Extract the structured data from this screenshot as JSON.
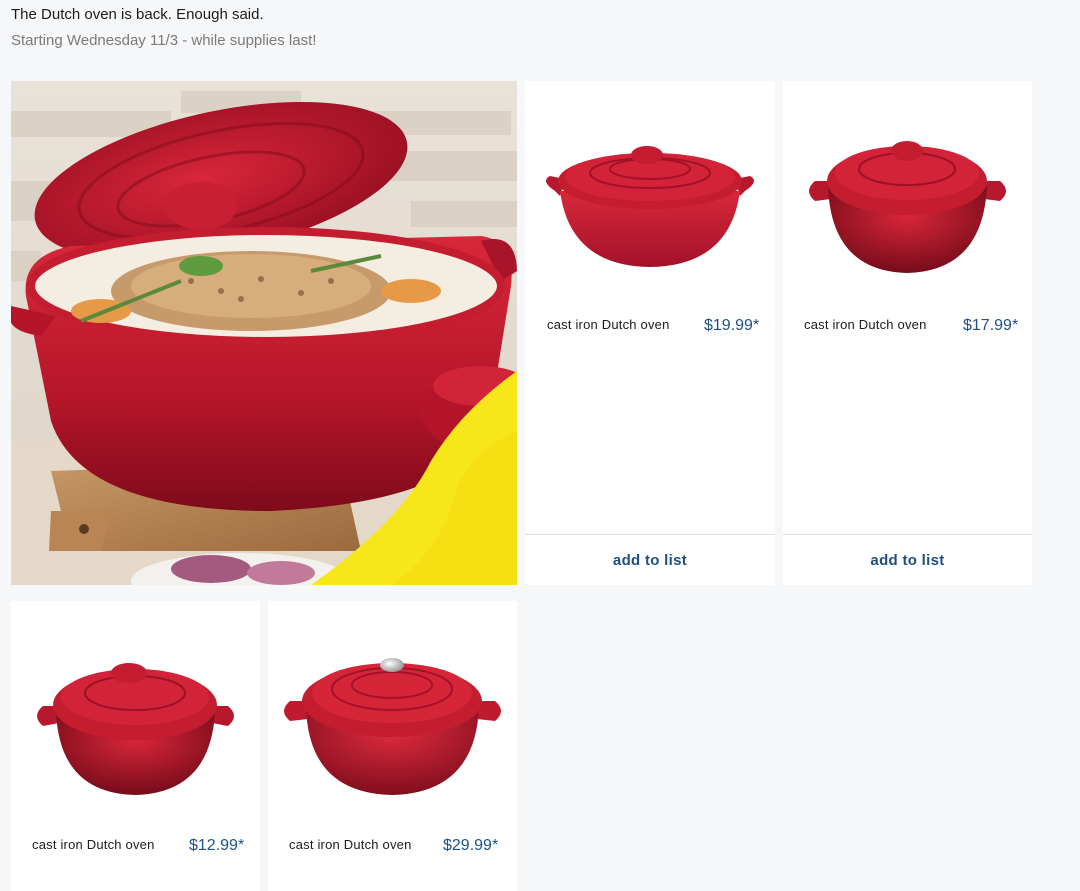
{
  "header": {
    "headline": "The Dutch oven is back. Enough said.",
    "subline": "Starting Wednesday 11/3 - while supplies last!"
  },
  "hero": {
    "icon": "hero-dutch-oven-image"
  },
  "products": [
    {
      "name": "cast iron Dutch oven",
      "price": "$19.99*",
      "action": "add to list",
      "icon": "oval-dutch-oven-image"
    },
    {
      "name": "cast iron Dutch oven",
      "price": "$17.99*",
      "action": "add to list",
      "icon": "round-dutch-oven-image"
    },
    {
      "name": "cast iron Dutch oven",
      "price": "$12.99*",
      "icon": "round-dutch-oven-image"
    },
    {
      "name": "cast iron Dutch oven",
      "price": "$29.99*",
      "icon": "round-dutch-oven-silver-knob-image"
    }
  ],
  "colors": {
    "accent": "#1e5184",
    "pot_red": "#c2192b",
    "yellow": "#f7e71a"
  }
}
